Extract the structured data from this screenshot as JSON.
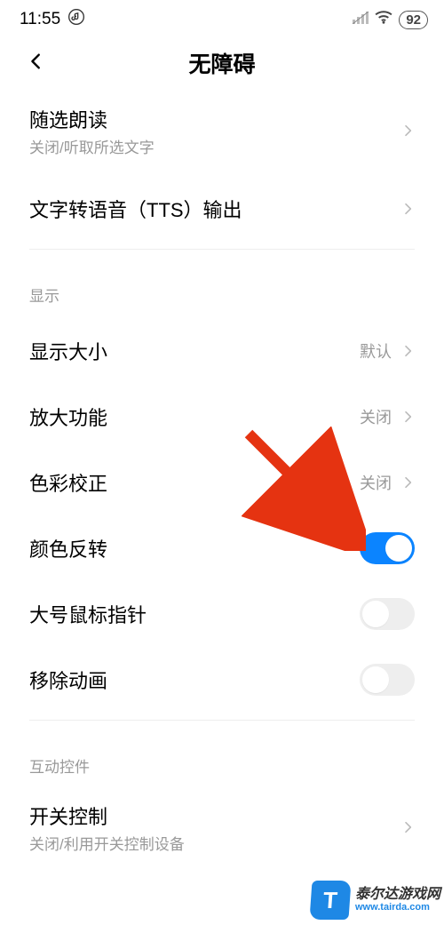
{
  "status": {
    "time": "11:55",
    "battery": "92"
  },
  "header": {
    "title": "无障碍"
  },
  "rows": {
    "select_speak": {
      "label": "随选朗读",
      "sub": "关闭/听取所选文字"
    },
    "tts": {
      "label": "文字转语音（TTS）输出"
    },
    "display_size": {
      "label": "显示大小",
      "value": "默认"
    },
    "magnify": {
      "label": "放大功能",
      "value": "关闭"
    },
    "color_corr": {
      "label": "色彩校正",
      "value": "关闭"
    },
    "color_inv": {
      "label": "颜色反转"
    },
    "big_cursor": {
      "label": "大号鼠标指针"
    },
    "remove_anim": {
      "label": "移除动画"
    },
    "switch_ctrl": {
      "label": "开关控制",
      "sub": "关闭/利用开关控制设备"
    }
  },
  "sections": {
    "display": "显示",
    "interaction": "互动控件"
  },
  "watermark": {
    "badge": "T",
    "cn": "泰尔达游戏网",
    "en": "www.tairda.com"
  }
}
